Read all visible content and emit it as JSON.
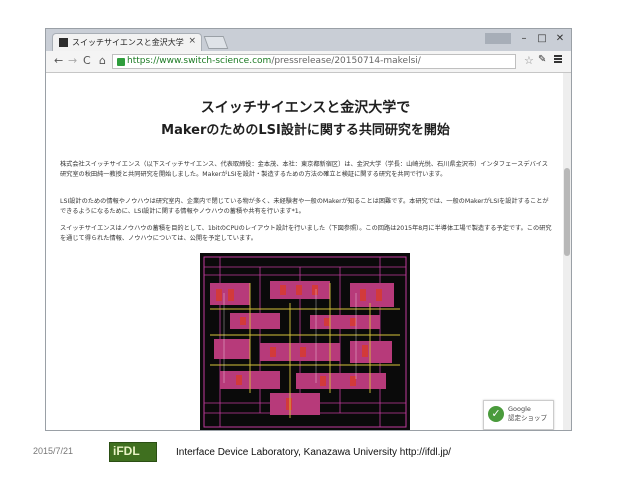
{
  "browser": {
    "tab_title": "スイッチサイエンスと金沢大学",
    "tab_close": "×",
    "url_host": "https://www.switch-science.com",
    "url_path": "/pressrelease/20150714-makelsi/",
    "back_glyph": "←",
    "forward_glyph": "→",
    "reload_glyph": "C",
    "home_glyph": "⌂",
    "star_glyph": "☆",
    "wrench_glyph": "✎"
  },
  "article": {
    "headline_line1": "スイッチサイエンスと金沢大学で",
    "headline_line2": "MakerのためのLSI設計に関する共同研究を開始",
    "paragraph1": "株式会社スイッチサイエンス（以下スイッチサイエンス、代表取締役：金本茂、本社：東京都新宿区）は、金沢大学（学長：山崎光悦、石川県金沢市）インタフェースデバイス研究室の秋田純一教授と共同研究を開始しました。MakerがLSIを設計・製造するための方法の確立と検証に関する研究を共同で行います。",
    "paragraph2": "LSI設計のための情報やノウハウは研究室内、企業内で閉じている物が多く、未経験者や一般のMakerが知ることは困難です。本研究では、一般のMakerがLSIを設計することができるようになるために、LSI設計に関する情報やノウハウの蓄積や共有を行います*1。",
    "paragraph3": "スイッチサイエンスはノウハウの蓄積を目的として、1bitのCPUのレイアウト設計を行いました（下図参照）。この回路は2015年8月に半導体工場で製造する予定です。この研究を通じて得られた情報、ノウハウについては、公開を予定しています。"
  },
  "badge": {
    "line1": "Google",
    "line2": "認定ショップ",
    "check_glyph": "✓"
  },
  "slide": {
    "date": "2015/7/21",
    "logo_text": "iFDL",
    "caption": "Interface Device Laboratory, Kanazawa University  http://ifdl.jp/"
  },
  "colors": {
    "logo_green": "#3f6f1f",
    "url_green": "#1a7a22",
    "layout_background": "#0a0a0a",
    "layout_magenta": "#c03a9c",
    "layout_red": "#d23a3a",
    "layout_yellow": "#d7c43a"
  }
}
